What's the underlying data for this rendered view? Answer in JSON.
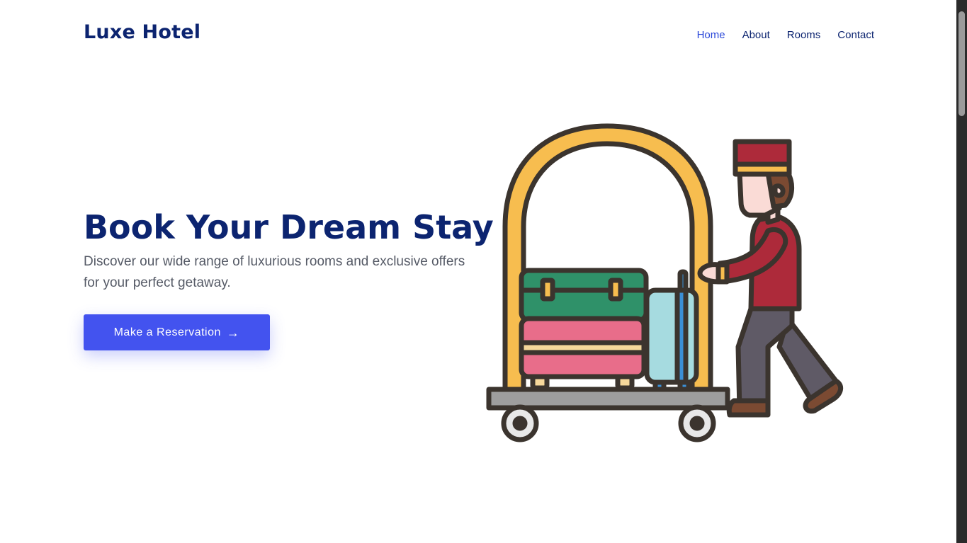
{
  "header": {
    "brand": "Luxe Hotel",
    "nav": [
      {
        "label": "Home",
        "active": true
      },
      {
        "label": "About",
        "active": false
      },
      {
        "label": "Rooms",
        "active": false
      },
      {
        "label": "Contact",
        "active": false
      }
    ]
  },
  "hero": {
    "title": "Book Your Dream Stay",
    "subtitle": "Discover our wide range of luxurious rooms and exclusive offers for your perfect getaway.",
    "cta_label": "Make a Reservation",
    "cta_icon": "arrow-right-icon",
    "illustration": "bellhop-luggage-cart-illustration"
  },
  "colors": {
    "brand_text": "#0c2470",
    "nav_active": "#2b48d9",
    "cta_background": "#4353ef",
    "body_text": "#555a66"
  }
}
